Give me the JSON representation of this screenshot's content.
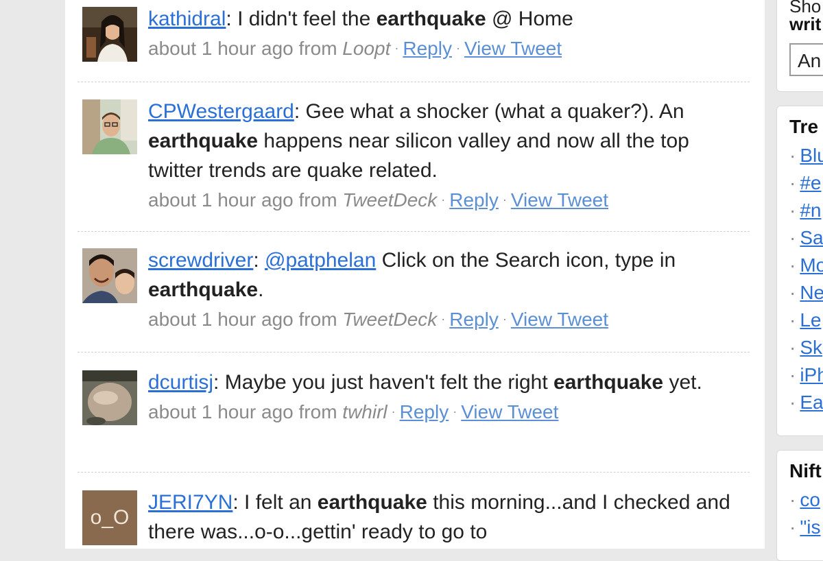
{
  "tweets": [
    {
      "user": "kathidral",
      "text_parts": [
        ": I didn't feel the ",
        "earthquake",
        " @ Home"
      ],
      "time": "about 1 hour ago from",
      "source": "Loopt",
      "reply": "Reply",
      "view": "View Tweet"
    },
    {
      "user": "CPWestergaard",
      "text_parts": [
        ": Gee what a shocker (what a quaker?). An ",
        "earthquake",
        " happens near silicon valley and now all the top twitter trends are quake related."
      ],
      "time": "about 1 hour ago from",
      "source": "TweetDeck",
      "reply": "Reply",
      "view": "View Tweet"
    },
    {
      "user": "screwdriver",
      "mention": "@patphelan",
      "text_parts": [
        ": ",
        " Click on the Search icon, type in ",
        "earthquake",
        "."
      ],
      "time": "about 1 hour ago from",
      "source": "TweetDeck",
      "reply": "Reply",
      "view": "View Tweet"
    },
    {
      "user": "dcurtisj",
      "text_parts": [
        ": Maybe you just haven't felt the right ",
        "earthquake",
        " yet."
      ],
      "time": "about 1 hour ago from",
      "source": "twhirl",
      "reply": "Reply",
      "view": "View Tweet"
    },
    {
      "user": "JERI7YN",
      "avatar_text": "o_O",
      "text_parts": [
        ": I felt an ",
        "earthquake",
        " this morning...and I checked and there was...o-o...gettin' ready to go to"
      ]
    }
  ],
  "sidebar": {
    "top_box": {
      "line1": "Sho",
      "line2": "writ",
      "input_value": "An"
    },
    "trends": {
      "title": "Tre",
      "items": [
        "Blu",
        "#e",
        "#n",
        "Sa",
        "Mo",
        "Ne",
        "Le",
        "Sk",
        "iPh",
        "Ea"
      ]
    },
    "nifty": {
      "title": "Nift",
      "items": [
        "co",
        "\"is"
      ]
    }
  },
  "colors": {
    "link": "#2a6fd6",
    "meta_gray": "#8a8a8a",
    "page_bg": "#e9e9e9"
  }
}
